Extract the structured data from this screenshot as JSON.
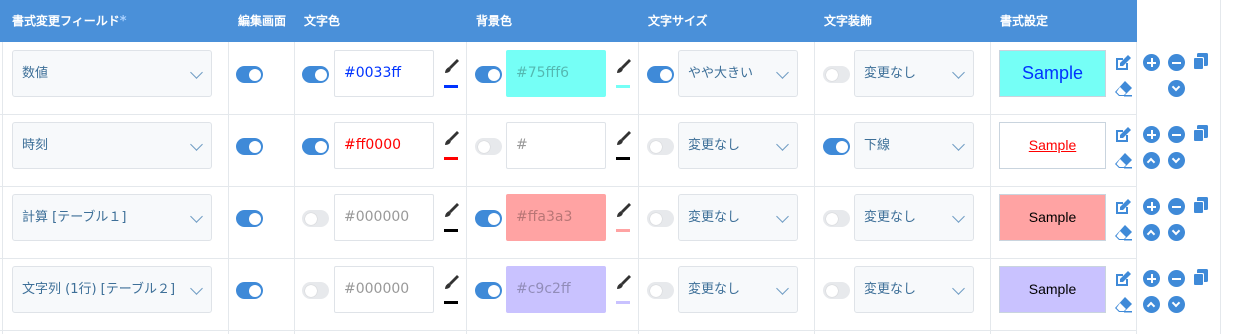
{
  "colors": {
    "header_bg": "#4a90d9",
    "toggle_on": "#3f8ad8",
    "toggle_off": "#e7e9ec",
    "icon_blue": "#3f8ad8",
    "select_text": "#3d6f98"
  },
  "header": {
    "field": "書式変更フィールド",
    "required_mark": "*",
    "edit_screen": "編集画面",
    "text_color": "文字色",
    "bg_color": "背景色",
    "font_size": "文字サイズ",
    "decoration": "文字装飾",
    "format": "書式設定"
  },
  "rows": [
    {
      "field": "数値",
      "edit_screen_on": true,
      "text_color_on": true,
      "text_color": "#0033ff",
      "text_color_swatch": "#0033ff",
      "bg_color_on": true,
      "bg_color": "#75fff6",
      "bg_color_swatch": "#75fff6",
      "font_size_on": true,
      "font_size": "やや大きい",
      "decoration_on": false,
      "decoration": "変更なし",
      "sample": "Sample",
      "has_up": false
    },
    {
      "field": "時刻",
      "edit_screen_on": true,
      "text_color_on": true,
      "text_color": "#ff0000",
      "text_color_swatch": "#ff0000",
      "bg_color_on": false,
      "bg_color": "#",
      "bg_color_swatch": "#000000",
      "font_size_on": false,
      "font_size": "変更なし",
      "decoration_on": true,
      "decoration": "下線",
      "sample": "Sample",
      "has_up": true
    },
    {
      "field": "計算 [テーブル１]",
      "edit_screen_on": true,
      "text_color_on": false,
      "text_color": "#000000",
      "text_color_swatch": "#000000",
      "bg_color_on": true,
      "bg_color": "#ffa3a3",
      "bg_color_swatch": "#ffa3a3",
      "font_size_on": false,
      "font_size": "変更なし",
      "decoration_on": false,
      "decoration": "変更なし",
      "sample": "Sample",
      "has_up": true
    },
    {
      "field": "文字列 (1行) [テーブル２]",
      "edit_screen_on": true,
      "text_color_on": false,
      "text_color": "#000000",
      "text_color_swatch": "#000000",
      "bg_color_on": true,
      "bg_color": "#c9c2ff",
      "bg_color_swatch": "#c9c2ff",
      "font_size_on": false,
      "font_size": "変更なし",
      "decoration_on": false,
      "decoration": "変更なし",
      "sample": "Sample",
      "has_up": true
    }
  ],
  "icons": {
    "edit": "edit-icon",
    "eraser": "eraser-icon",
    "add": "plus-circle-icon",
    "remove": "minus-circle-icon",
    "copy": "copy-icon",
    "move_up": "chevron-up-circle-icon",
    "move_down": "chevron-down-circle-icon",
    "brush": "paintbrush-icon",
    "dropdown": "chevron-down-icon"
  }
}
